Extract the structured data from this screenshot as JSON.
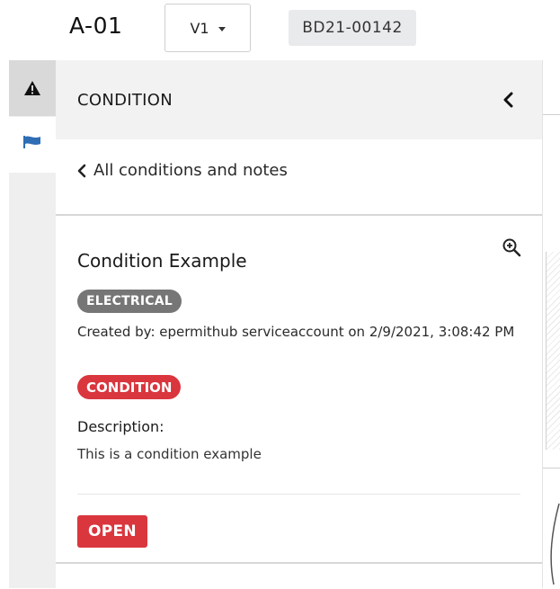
{
  "header": {
    "sheet_label": "A-01",
    "version": "V1",
    "permit_number": "BD21-00142"
  },
  "rail": {
    "tabs": [
      {
        "icon": "warning-icon",
        "active": true
      },
      {
        "icon": "flag-icon",
        "active": false
      }
    ]
  },
  "panel": {
    "title": "CONDITION",
    "back_link": "All conditions and notes",
    "condition": {
      "title": "Condition Example",
      "category_tag": "ELECTRICAL",
      "created_by": "Created by: epermithub serviceaccount on 2/9/2021, 3:08:42 PM",
      "type_tag": "CONDITION",
      "description_label": "Description:",
      "description": "This is a condition example",
      "status": "OPEN"
    }
  },
  "colors": {
    "accent_red": "#d9363e",
    "tag_gray": "#767676",
    "flag_blue": "#2f6db5"
  }
}
